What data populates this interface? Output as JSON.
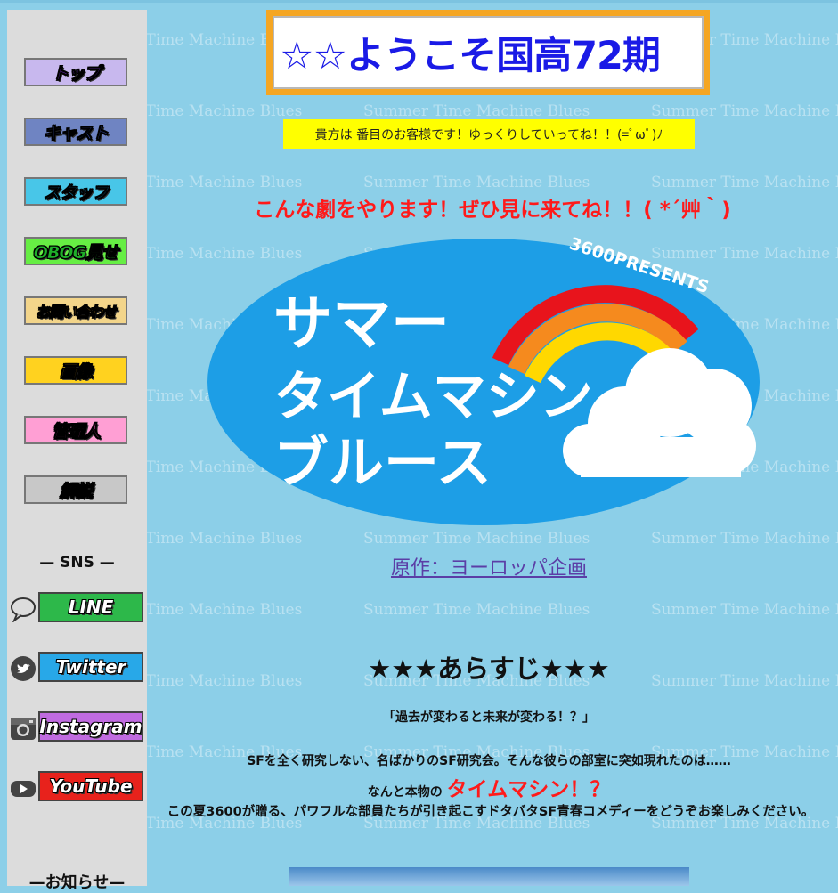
{
  "watermark": "Summer Time Machine Blues",
  "sidebar": {
    "nav": [
      {
        "label": "トップ",
        "bg": "#c8b8ee",
        "fg": "#7a2fd6"
      },
      {
        "label": "キャスト",
        "bg": "#6f84c2",
        "fg": "#3a4fb0"
      },
      {
        "label": "スタッフ",
        "bg": "#48c6e8",
        "fg": "#1596c8"
      },
      {
        "label": "OBOG見せ",
        "bg": "#66ee44",
        "fg": "#1fb02a"
      },
      {
        "label": "お問い合わせ",
        "bg": "#f3d58a",
        "fg": "#d89b22"
      },
      {
        "label": "画像",
        "bg": "#ffd21f",
        "fg": "#d99d10"
      },
      {
        "label": "管理人",
        "bg": "#ff9fd4",
        "fg": "#e052ad"
      },
      {
        "label": "解説",
        "bg": "#c8c8c8",
        "fg": "#555555"
      }
    ],
    "sns_title": "— SNS —",
    "sns": [
      {
        "label": "LINE",
        "icon": "speech-bubble-icon",
        "bg": "#2db84a"
      },
      {
        "label": "Twitter",
        "icon": "twitter-bird-icon",
        "bg": "#28a8e8"
      },
      {
        "label": "Instagram",
        "icon": "camera-icon",
        "bg": "#c06be0"
      },
      {
        "label": "YouTube",
        "icon": "play-icon",
        "bg": "#e8221c"
      }
    ],
    "news_title": "—お知らせ—"
  },
  "main": {
    "title": "☆☆ようこそ国高72期",
    "visitor_text": "貴方は 番目のお客様です！ゆっくりしていってね！！(=ﾟωﾟ)ﾉ",
    "tagline": "こんな劇をやります！ぜひ見に来てね！！( *´艸｀)",
    "poster": {
      "line1": "サマー",
      "line2": "タイムマシン・",
      "line3": "ブルース",
      "badge": "3600PRESENTS"
    },
    "source_link": "原作：ヨーロッパ企画",
    "synopsis_title": "★★★あらすじ★★★",
    "quote": "「過去が変わると未来が変わる！？」",
    "para1": "SFを全く研究しない、名ばかりのSF研究会。そんな彼らの部室に突如現れたのは……",
    "para2_prefix": "なんと本物の",
    "para2_highlight": "タイムマシン！？",
    "para3": "この夏3600が贈る、パワフルな部員たちが引き起こすドタバタSF青春コメディーをどうぞお楽しみください。"
  }
}
